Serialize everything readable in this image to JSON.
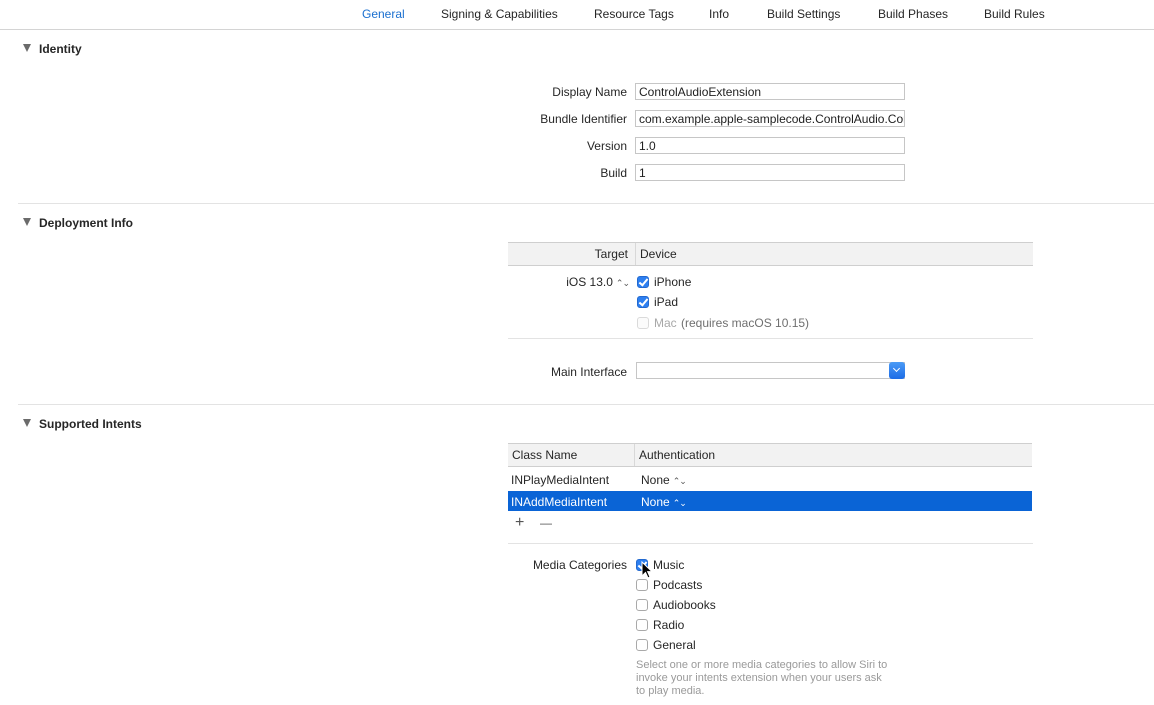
{
  "tabs": [
    {
      "label": "General",
      "active": true
    },
    {
      "label": "Signing & Capabilities"
    },
    {
      "label": "Resource Tags"
    },
    {
      "label": "Info"
    },
    {
      "label": "Build Settings"
    },
    {
      "label": "Build Phases"
    },
    {
      "label": "Build Rules"
    }
  ],
  "identity": {
    "title": "Identity",
    "display_name_label": "Display Name",
    "display_name_value": "ControlAudioExtension",
    "bundle_id_label": "Bundle Identifier",
    "bundle_id_value": "com.example.apple-samplecode.ControlAudio.Con",
    "version_label": "Version",
    "version_value": "1.0",
    "build_label": "Build",
    "build_value": "1"
  },
  "deployment": {
    "title": "Deployment Info",
    "col_target": "Target",
    "col_device": "Device",
    "target_value": "iOS 13.0",
    "devices": [
      {
        "label": "iPhone",
        "checked": true
      },
      {
        "label": "iPad",
        "checked": true
      },
      {
        "label": "Mac",
        "checked": false,
        "disabled": true
      }
    ],
    "mac_note": "(requires macOS 10.15)",
    "main_interface_label": "Main Interface",
    "main_interface_value": ""
  },
  "intents": {
    "title": "Supported Intents",
    "col_class": "Class Name",
    "col_auth": "Authentication",
    "rows": [
      {
        "class_name": "INPlayMediaIntent",
        "auth": "None",
        "selected": false
      },
      {
        "class_name": "INAddMediaIntent",
        "auth": "None",
        "selected": true
      }
    ],
    "add_symbol": "+",
    "remove_symbol": "—",
    "media_label": "Media Categories",
    "categories": [
      {
        "label": "Music",
        "checked": true
      },
      {
        "label": "Podcasts",
        "checked": false
      },
      {
        "label": "Audiobooks",
        "checked": false
      },
      {
        "label": "Radio",
        "checked": false
      },
      {
        "label": "General",
        "checked": false
      }
    ],
    "help_lines": [
      "Select one or more media categories to allow Siri to",
      "invoke your intents extension when your users ask",
      "to play media."
    ]
  },
  "colors": {
    "accent": "#1a6fcf",
    "selection": "#0a64d6"
  }
}
